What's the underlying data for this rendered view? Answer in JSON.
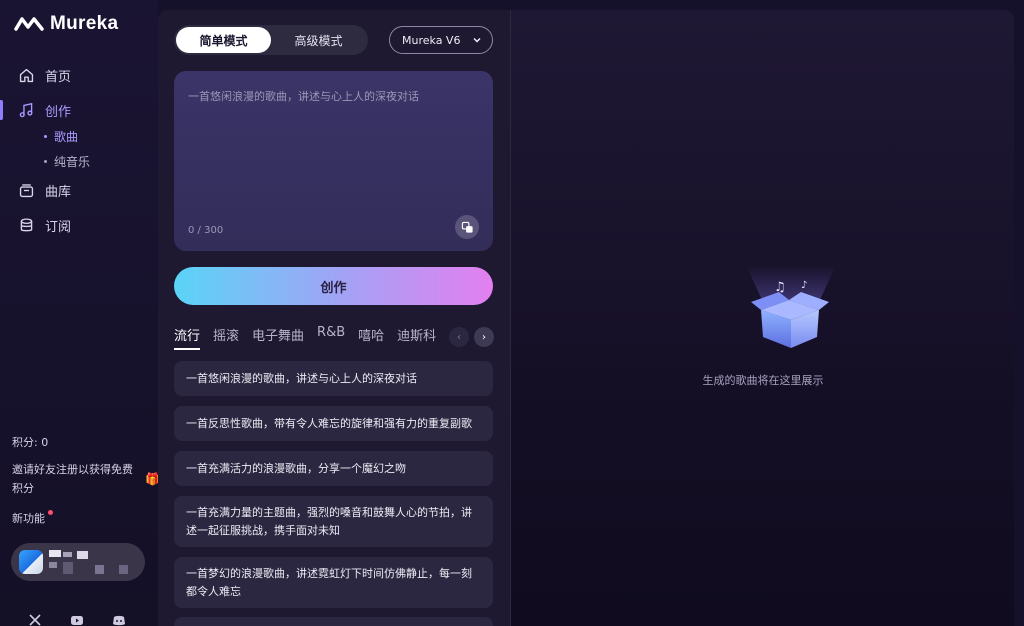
{
  "app": {
    "name": "Mureka"
  },
  "sidebar": {
    "items": [
      {
        "label": "首页",
        "icon": "home-icon"
      },
      {
        "label": "创作",
        "icon": "music-note-icon",
        "active": true
      },
      {
        "label": "曲库",
        "icon": "library-icon"
      },
      {
        "label": "订阅",
        "icon": "subscription-icon"
      }
    ],
    "sub_items": [
      {
        "label": "歌曲",
        "active": true
      },
      {
        "label": "纯音乐"
      }
    ],
    "credits": "积分: 0",
    "invite": "邀请好友注册以获得免费积分",
    "new_features": "新功能"
  },
  "composer": {
    "modes": [
      "简单模式",
      "高级模式"
    ],
    "active_mode": "简单模式",
    "model": "Mureka V6",
    "prompt_placeholder": "一首悠闲浪漫的歌曲，讲述与心上人的深夜对话",
    "char_count": "0 / 300",
    "create_label": "创作",
    "genres": [
      "流行",
      "摇滚",
      "电子舞曲",
      "R&B",
      "嘻哈",
      "迪斯科"
    ],
    "active_genre": "流行",
    "suggestions": [
      "一首悠闲浪漫的歌曲，讲述与心上人的深夜对话",
      "一首反思性歌曲，带有令人难忘的旋律和强有力的重复副歌",
      "一首充满活力的浪漫歌曲，分享一个魔幻之吻",
      "一首充满力量的主题曲，强烈的嗓音和鼓舞人心的节拍，讲述一起征服挑战，携手面对未知",
      "一首梦幻的浪漫歌曲，讲述霓虹灯下时间仿佛静止，每一刻都令人难忘"
    ]
  },
  "output": {
    "empty_text": "生成的歌曲将在这里展示"
  },
  "colors": {
    "accent": "#a99bff",
    "background": "#16112a",
    "panel": "#1e1930"
  }
}
